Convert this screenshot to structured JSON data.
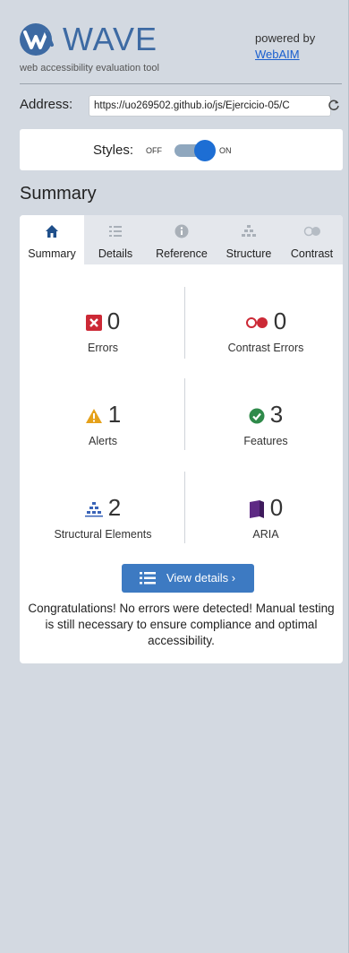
{
  "header": {
    "logo_text": "WAVE",
    "logo_sub": "web accessibility evaluation tool",
    "powered_by": "powered by",
    "webaim_link": "WebAIM"
  },
  "address": {
    "label": "Address:",
    "value": "https://uo269502.github.io/js/Ejercicio-05/C",
    "reload_icon": "reload-icon"
  },
  "styles": {
    "label": "Styles:",
    "off": "OFF",
    "on": "ON",
    "state": "on"
  },
  "summary": {
    "heading": "Summary"
  },
  "tabs": [
    {
      "label": "Summary",
      "icon": "home-icon",
      "active": true
    },
    {
      "label": "Details",
      "icon": "list-icon",
      "active": false
    },
    {
      "label": "Reference",
      "icon": "info-icon",
      "active": false
    },
    {
      "label": "Structure",
      "icon": "structure-icon",
      "active": false
    },
    {
      "label": "Contrast",
      "icon": "contrast-icon",
      "active": false
    }
  ],
  "stats": {
    "errors": {
      "count": "0",
      "label": "Errors"
    },
    "contrast_errors": {
      "count": "0",
      "label": "Contrast Errors"
    },
    "alerts": {
      "count": "1",
      "label": "Alerts"
    },
    "features": {
      "count": "3",
      "label": "Features"
    },
    "structural": {
      "count": "2",
      "label": "Structural Elements"
    },
    "aria": {
      "count": "0",
      "label": "ARIA"
    }
  },
  "view_details": {
    "label": "View details ›"
  },
  "congrats": "Congratulations! No errors were detected! Manual testing is still necessary to ensure compliance and optimal accessibility.",
  "colors": {
    "background": "#d3d9e1",
    "accent": "#1d6ed4",
    "button": "#3d7ac2",
    "error": "#cc2936",
    "alert": "#e5a11a",
    "feature": "#2f8a4a",
    "structure": "#3a64b8",
    "aria": "#5e2a84"
  }
}
